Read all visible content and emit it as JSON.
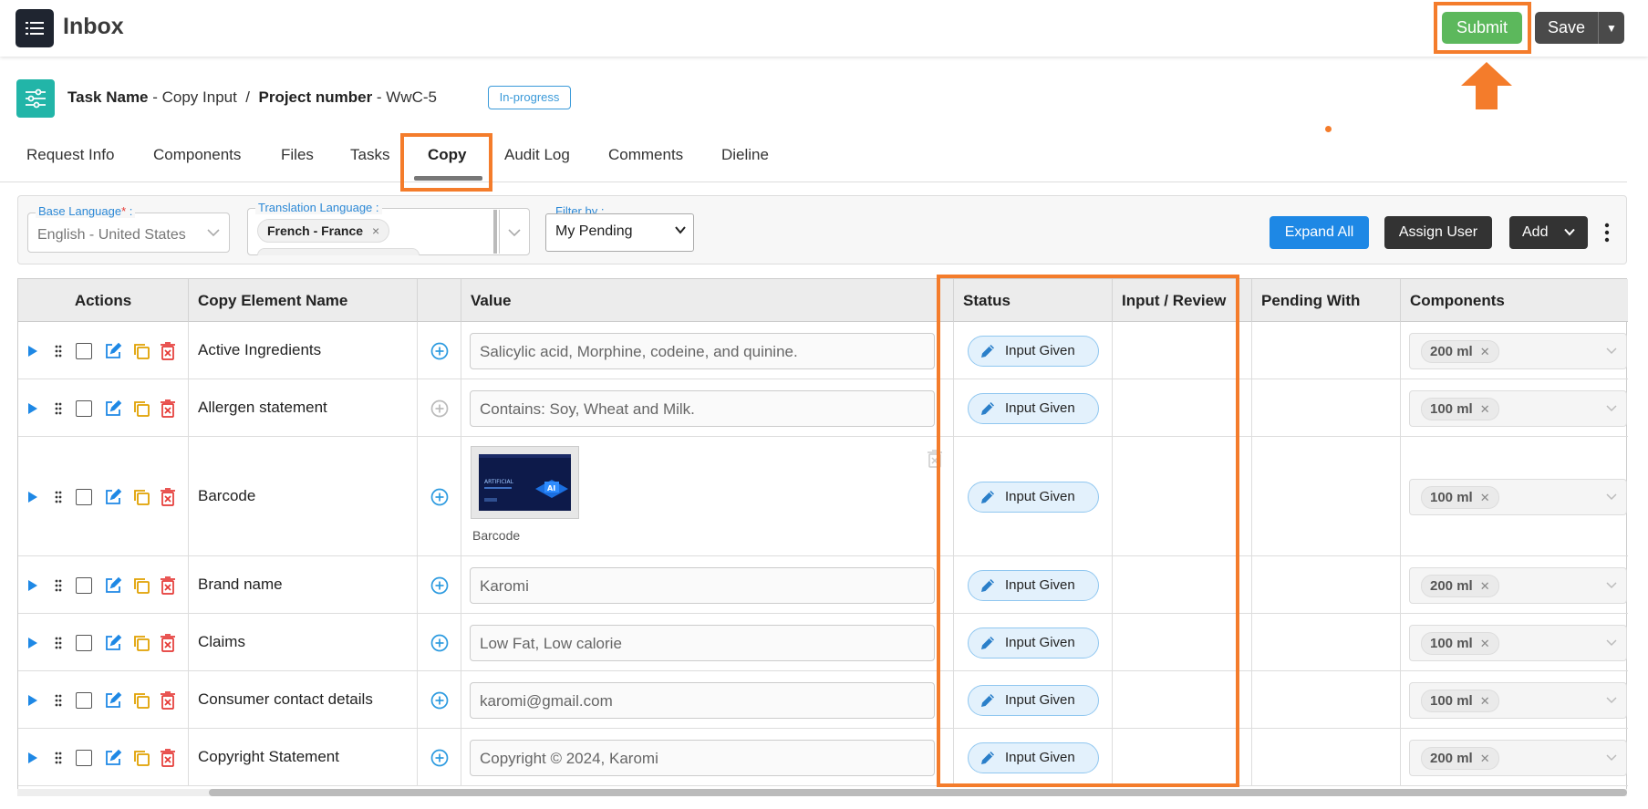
{
  "header": {
    "title": "Inbox",
    "submit_label": "Submit",
    "save_label": "Save"
  },
  "task": {
    "task_name_label": "Task Name",
    "task_name_value": "Copy Input",
    "project_label": "Project number",
    "project_value": "WwC-5",
    "status": "In-progress"
  },
  "tabs": [
    {
      "label": "Request Info"
    },
    {
      "label": "Components"
    },
    {
      "label": "Files"
    },
    {
      "label": "Tasks"
    },
    {
      "label": "Copy",
      "active": true
    },
    {
      "label": "Audit Log"
    },
    {
      "label": "Comments"
    },
    {
      "label": "Dieline"
    }
  ],
  "filters": {
    "base_language_label": "Base Language",
    "base_language_value": "English - United States",
    "translation_language_label": "Translation Language :",
    "translation_language_chip": "French - France",
    "filter_by_label": "Filter by :",
    "filter_by_value": "My Pending",
    "expand_all_label": "Expand All",
    "assign_user_label": "Assign User",
    "add_label": "Add"
  },
  "table": {
    "headers": {
      "actions": "Actions",
      "copy_element_name": "Copy Element Name",
      "value": "Value",
      "status": "Status",
      "input_review": "Input / Review",
      "pending_with": "Pending With",
      "components": "Components"
    },
    "rows": [
      {
        "name": "Active Ingredients",
        "value": "Salicylic acid, Morphine, codeine, and quinine.",
        "status": "Input Given",
        "component": "200 ml"
      },
      {
        "name": "Allergen statement",
        "value": "Contains: Soy, Wheat and Milk.",
        "status": "Input Given",
        "component": "100 ml"
      },
      {
        "name": "Barcode",
        "value": "",
        "image_caption": "Barcode",
        "status": "Input Given",
        "component": "100 ml"
      },
      {
        "name": "Brand name",
        "value": "Karomi",
        "status": "Input Given",
        "component": "200 ml"
      },
      {
        "name": "Claims",
        "value": "Low Fat, Low calorie",
        "status": "Input Given",
        "component": "100 ml"
      },
      {
        "name": "Consumer contact details",
        "value": "karomi@gmail.com",
        "status": "Input Given",
        "component": "100 ml"
      },
      {
        "name": "Copyright Statement",
        "value": "Copyright © 2024, Karomi",
        "status": "Input Given",
        "component": "200 ml"
      }
    ]
  },
  "colors": {
    "highlight": "#f47c2b",
    "submit": "#5cb85c",
    "accent": "#1e88e5"
  }
}
